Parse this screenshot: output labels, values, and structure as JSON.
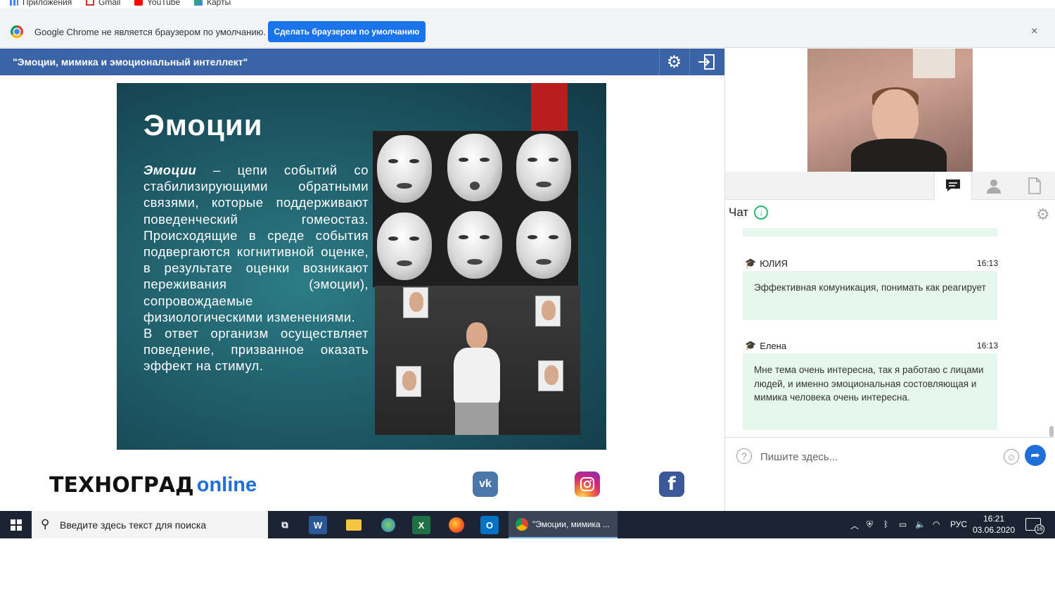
{
  "bookmarks": [
    "Приложения",
    "Gmail",
    "YouTube",
    "Карты"
  ],
  "infobar": {
    "message": "Google Chrome не является браузером по умолчанию.",
    "button": "Сделать браузером по умолчанию",
    "close": "×"
  },
  "presentation": {
    "title": "\"Эмоции, мимика и эмоциональный интеллект\"",
    "slide": {
      "heading": "Эмоции",
      "term": "Эмоции",
      "paragraph1": " – цепи событий со стабилизирующими обратными связями, которые поддерживают поведенческий гомеостаз. Происходящие в среде события подвергаются когнитивной оценке, в результате оценки возникают переживания (эмоции), сопровождаемые физиологическими изменениями.",
      "paragraph2": "В ответ организм осуществляет поведение, призванное оказать эффект на стимул."
    }
  },
  "branding": {
    "logo_text": "ТЕХНОГРАД",
    "logo_suffix": "online",
    "vk": "vk"
  },
  "chat": {
    "title": "Чат",
    "messages": [
      {
        "author": "ЮЛИЯ",
        "time": "16:13",
        "text": "Эффективная комуникация, понимать как реагирует"
      },
      {
        "author": "Елена",
        "time": "16:13",
        "text": "Мне тема очень интересна, так я работаю с лицами людей, и именно эмоциональная состовляющая и мимика человека очень интересна."
      }
    ],
    "placeholder": "Пишите здесь..."
  },
  "taskbar": {
    "search_placeholder": "Введите здесь текст для поиска",
    "chrome_task": "\"Эмоции, мимика ...",
    "lang": "РУС",
    "time": "16:21",
    "date": "03.06.2020",
    "notifications": "16"
  }
}
